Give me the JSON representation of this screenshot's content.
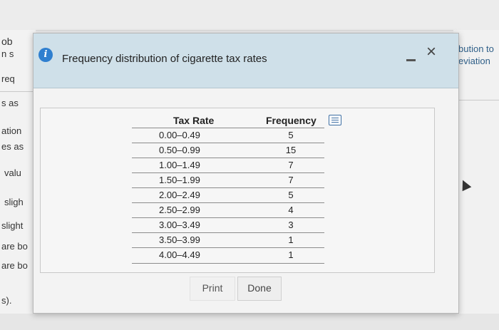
{
  "background": {
    "left_fragments": [
      "ob",
      "n s",
      "req",
      "s as",
      "ation",
      "es as",
      "valu",
      "sligh",
      "slight",
      "are bo",
      "are bo",
      "s)."
    ],
    "right_fragments": [
      "bution to",
      "eviation"
    ]
  },
  "dialog": {
    "title": "Frequency distribution of cigarette tax rates",
    "info_icon": "i",
    "close_glyph": "×"
  },
  "table": {
    "headers": {
      "rate": "Tax Rate",
      "frequency": "Frequency"
    },
    "rows": [
      {
        "rate": "0.00–0.49",
        "frequency": "5"
      },
      {
        "rate": "0.50–0.99",
        "frequency": "15"
      },
      {
        "rate": "1.00–1.49",
        "frequency": "7"
      },
      {
        "rate": "1.50–1.99",
        "frequency": "7"
      },
      {
        "rate": "2.00–2.49",
        "frequency": "5"
      },
      {
        "rate": "2.50–2.99",
        "frequency": "4"
      },
      {
        "rate": "3.00–3.49",
        "frequency": "3"
      },
      {
        "rate": "3.50–3.99",
        "frequency": "1"
      },
      {
        "rate": "4.00–4.49",
        "frequency": "1"
      }
    ]
  },
  "buttons": {
    "print": "Print",
    "done": "Done"
  },
  "colors": {
    "header_bg": "#cfe0e9",
    "info_icon": "#2f7fcf",
    "export_icon": "#3d6ea3"
  }
}
